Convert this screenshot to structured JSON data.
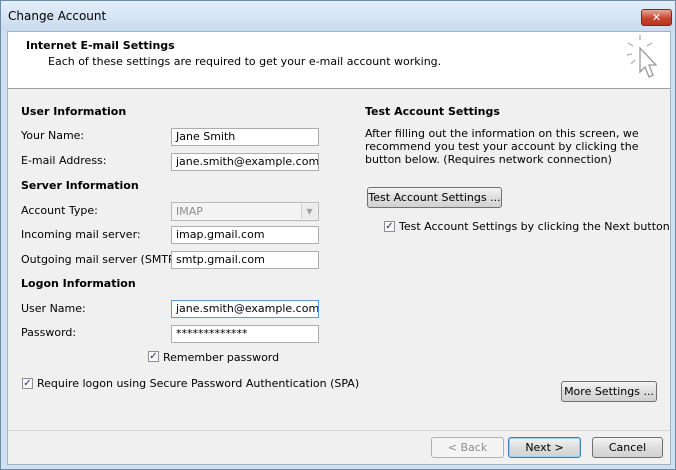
{
  "window": {
    "title": "Change Account",
    "close_glyph": "✕"
  },
  "header": {
    "title": "Internet E-mail Settings",
    "description": "Each of these settings are required to get your e-mail account working."
  },
  "user_info": {
    "section_title": "User Information",
    "name_label": "Your Name:",
    "name_value": "Jane Smith",
    "email_label": "E-mail Address:",
    "email_value": "jane.smith@example.com"
  },
  "server_info": {
    "section_title": "Server Information",
    "account_type_label": "Account Type:",
    "account_type_value": "IMAP",
    "incoming_label": "Incoming mail server:",
    "incoming_value": "imap.gmail.com",
    "outgoing_label": "Outgoing mail server (SMTP):",
    "outgoing_value": "smtp.gmail.com"
  },
  "logon_info": {
    "section_title": "Logon Information",
    "username_label": "User Name:",
    "username_value": "jane.smith@example.com",
    "password_label": "Password:",
    "password_value": "*************",
    "remember_label": "Remember password",
    "remember_checked": true,
    "spa_label": "Require logon using Secure Password Authentication (SPA)",
    "spa_checked": true
  },
  "test_settings": {
    "section_title": "Test Account Settings",
    "description": "After filling out the information on this screen, we recommend you test your account by clicking the button below. (Requires network connection)",
    "test_button_label": "Test Account Settings ...",
    "auto_test_label": "Test Account Settings by clicking the Next button",
    "auto_test_checked": true
  },
  "more_settings_label": "More Settings ...",
  "footer": {
    "back_label": "< Back",
    "next_label": "Next >",
    "cancel_label": "Cancel"
  },
  "icons": {
    "check_glyph": "✓",
    "dropdown_glyph": "▼"
  }
}
